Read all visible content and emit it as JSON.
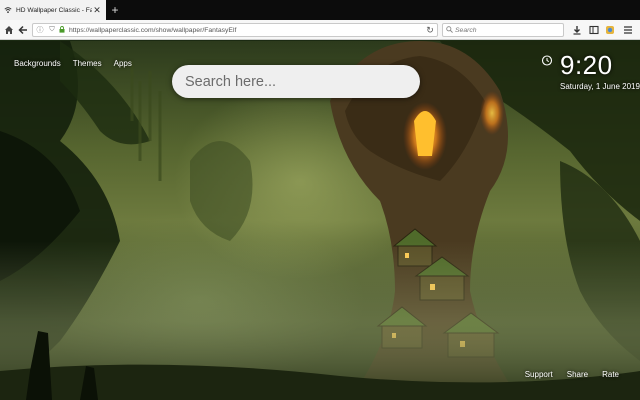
{
  "browser": {
    "tab": {
      "title": "HD Wallpaper Classic - Fantasy Elf",
      "close_glyph": "✕"
    },
    "new_tab_glyph": "+",
    "url": "https://wallpaperclassic.com/show/wallpaper/FantasyElf",
    "search_placeholder": "Search"
  },
  "nav": {
    "links": [
      "Backgrounds",
      "Themes",
      "Apps"
    ]
  },
  "search": {
    "placeholder": "Search here..."
  },
  "clock": {
    "time": "9:20",
    "date": "Saturday, 1 June 2019"
  },
  "footer": {
    "links": [
      "Support",
      "Share",
      "Rate"
    ]
  },
  "icons": {
    "home": "home-icon",
    "info": "info-icon",
    "shield": "shield-icon",
    "lock": "lock-icon",
    "reload": "reload-icon",
    "search": "search-icon",
    "download": "download-icon",
    "reader": "reader-view-icon",
    "extension": "extension-icon",
    "menu": "hamburger-menu-icon",
    "alarm": "alarm-clock-icon"
  },
  "colors": {
    "tab_bar": "#0c0c0c",
    "nav_bar": "#f7f7f7",
    "search_box": "#efefef",
    "overlay_text": "#ffffff"
  }
}
